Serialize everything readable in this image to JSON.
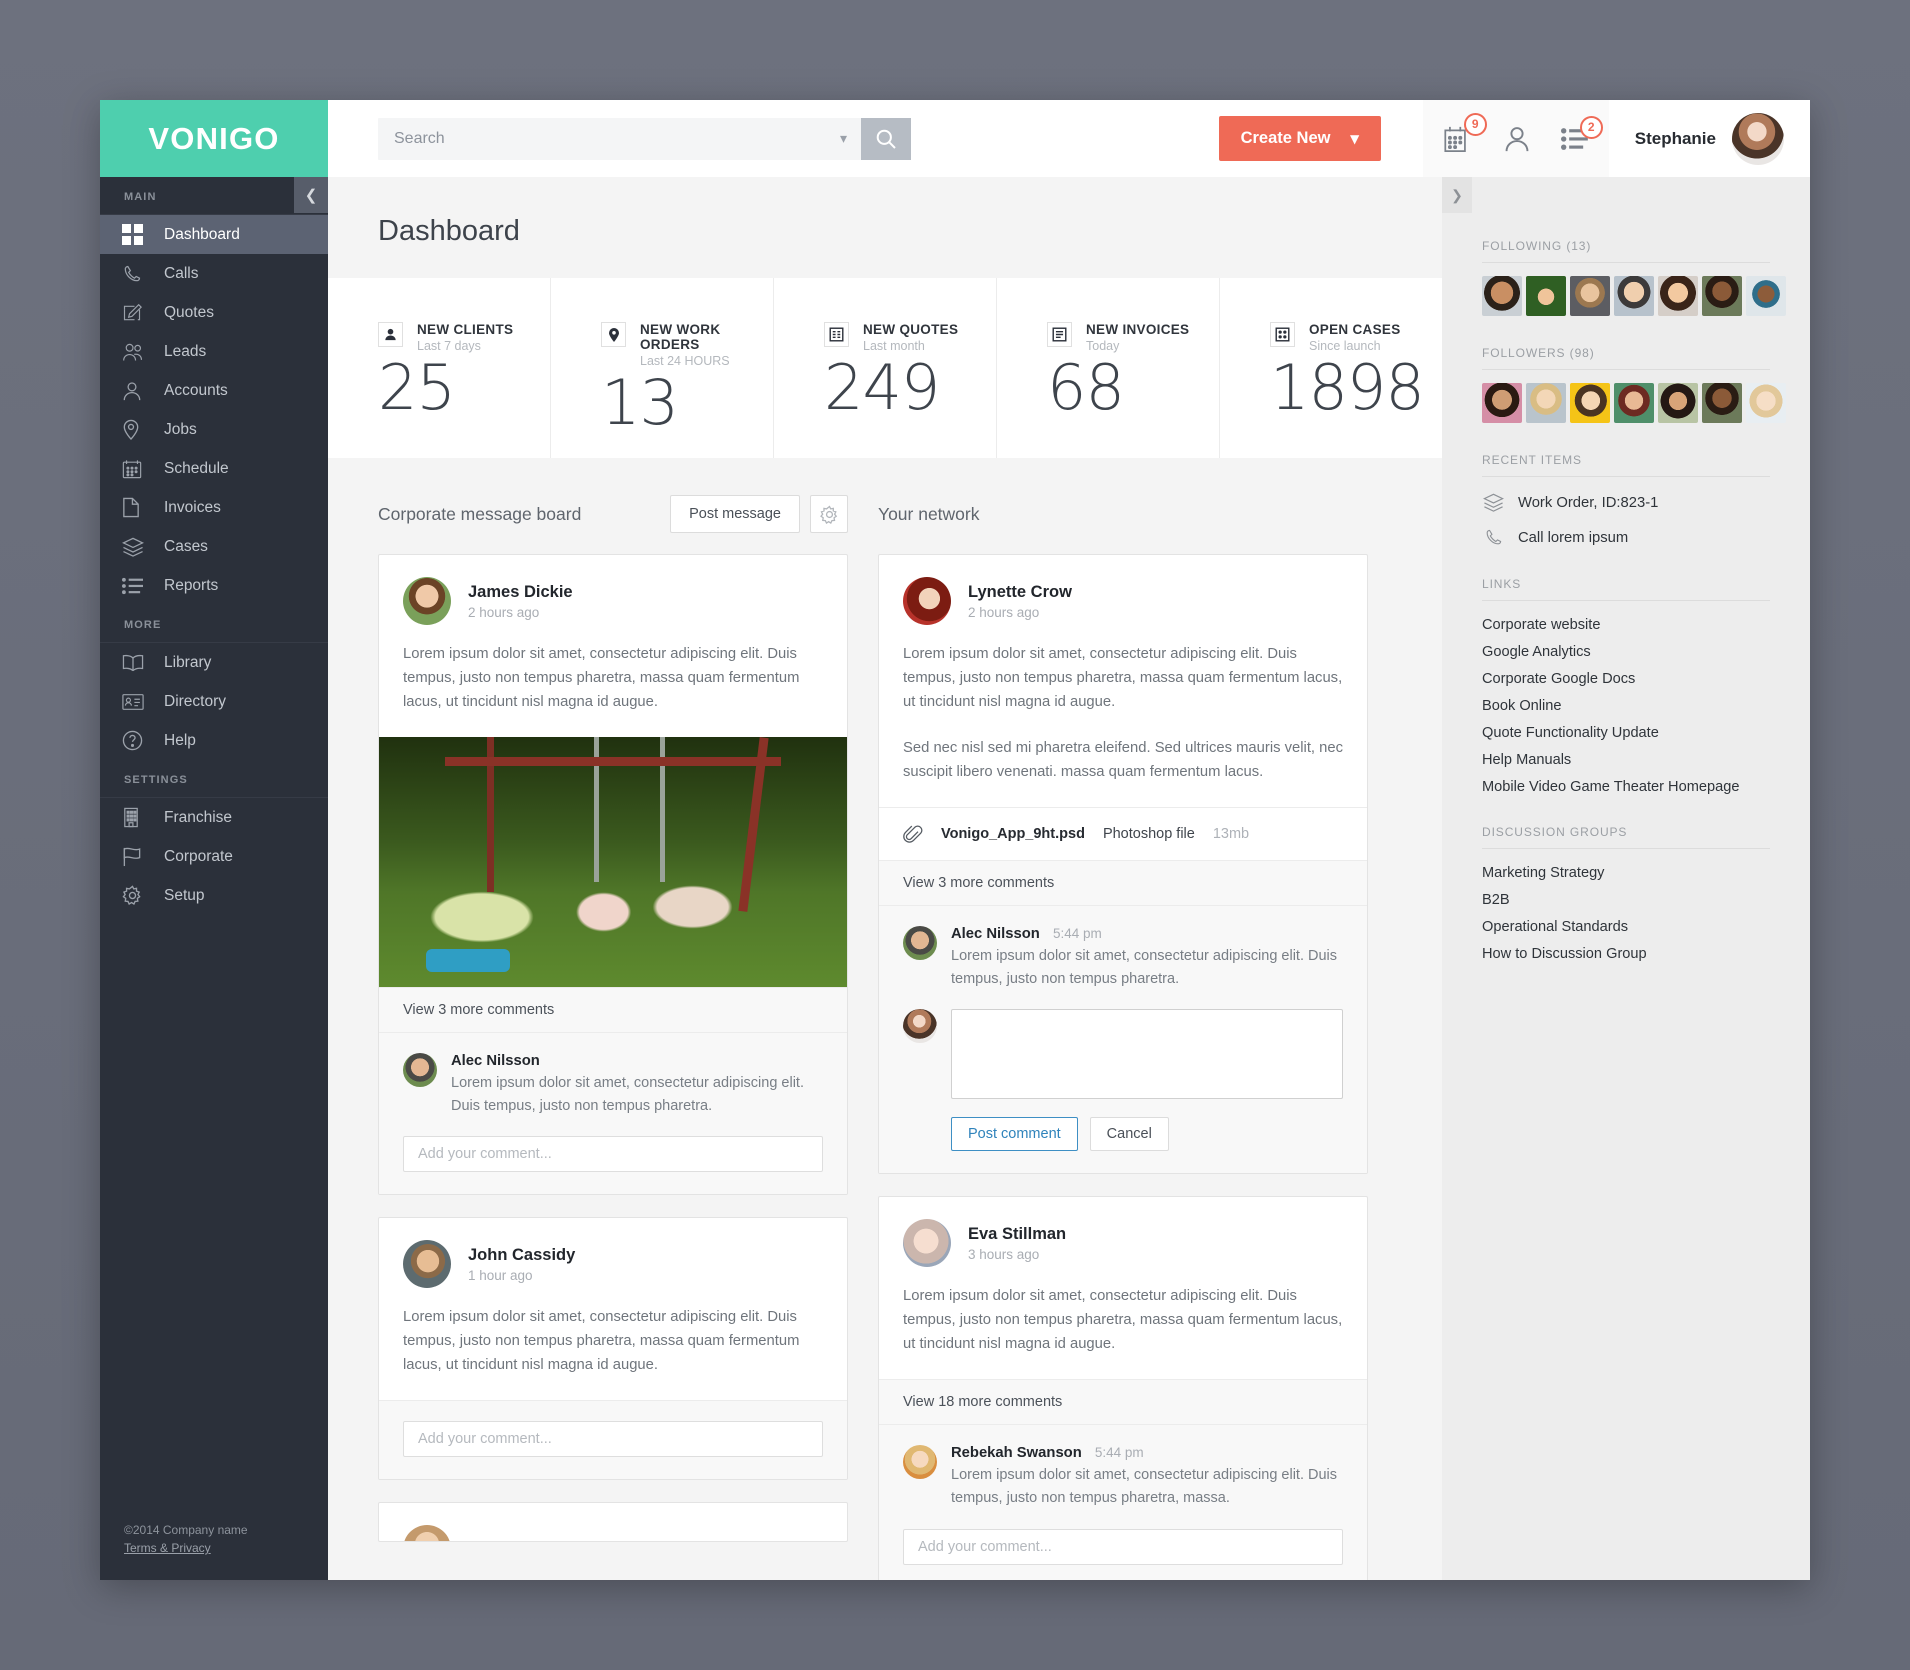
{
  "brand": {
    "logo": "VONIGO",
    "accent": "#4ecfae",
    "cta_color": "#ef6a56"
  },
  "sidebar": {
    "sections": [
      {
        "label": "MAIN",
        "items": [
          {
            "label": "Dashboard",
            "icon": "grid-icon",
            "active": true
          },
          {
            "label": "Calls",
            "icon": "phone-icon"
          },
          {
            "label": "Quotes",
            "icon": "pencil-square-icon"
          },
          {
            "label": "Leads",
            "icon": "users-icon"
          },
          {
            "label": "Accounts",
            "icon": "user-icon"
          },
          {
            "label": "Jobs",
            "icon": "map-pin-icon"
          },
          {
            "label": "Schedule",
            "icon": "calendar-icon"
          },
          {
            "label": "Invoices",
            "icon": "document-icon"
          },
          {
            "label": "Cases",
            "icon": "layers-icon"
          },
          {
            "label": "Reports",
            "icon": "list-icon"
          }
        ]
      },
      {
        "label": "MORE",
        "items": [
          {
            "label": "Library",
            "icon": "book-icon"
          },
          {
            "label": "Directory",
            "icon": "id-card-icon"
          },
          {
            "label": "Help",
            "icon": "question-circle-icon"
          }
        ]
      },
      {
        "label": "SETTINGS",
        "items": [
          {
            "label": "Franchise",
            "icon": "building-icon"
          },
          {
            "label": "Corporate",
            "icon": "flag-icon"
          },
          {
            "label": "Setup",
            "icon": "gear-icon"
          }
        ]
      }
    ],
    "collapse_icon": "chevron-left-icon",
    "footer": {
      "copyright": "©2014 Company name",
      "terms": "Terms & Privacy"
    }
  },
  "topbar": {
    "search_placeholder": "Search",
    "search_value": "",
    "search_caret_icon": "chevron-down-icon",
    "search_button_icon": "search-icon",
    "create_label": "Create New",
    "create_caret_icon": "chevron-down-icon",
    "icons": [
      {
        "name": "calendar-add-icon",
        "badge": "9"
      },
      {
        "name": "user-icon",
        "badge": ""
      },
      {
        "name": "task-list-icon",
        "badge": "2"
      }
    ],
    "user": {
      "name": "Stephanie",
      "avatar": "avatar-stephanie"
    }
  },
  "page": {
    "title": "Dashboard"
  },
  "kpis": [
    {
      "icon": "client-icon",
      "label": "NEW CLIENTS",
      "sub": "Last 7 days",
      "value": "25"
    },
    {
      "icon": "map-pin-icon",
      "label": "NEW WORK ORDERS",
      "sub": "Last 24 HOURS",
      "value": "13"
    },
    {
      "icon": "quote-grid-icon",
      "label": "NEW QUOTES",
      "sub": "Last month",
      "value": "249"
    },
    {
      "icon": "invoice-icon",
      "label": "NEW INVOICES",
      "sub": "Today",
      "value": "68"
    },
    {
      "icon": "cases-grid-icon",
      "label": "OPEN CASES",
      "sub": "Since launch",
      "value": "1898"
    }
  ],
  "message_board": {
    "title": "Corporate message board",
    "post_message_label": "Post message",
    "settings_icon": "gear-icon",
    "posts": [
      {
        "author": "James Dickie",
        "time": "2 hours ago",
        "body": "Lorem ipsum dolor sit amet, consectetur adipiscing elit. Duis tempus, justo non tempus pharetra, massa quam fermentum lacus, ut tincidunt nisl magna id augue.",
        "has_image": true,
        "image_alt": "children-on-swings-photo",
        "view_more": "View 3 more comments",
        "comments": [
          {
            "author": "Alec Nilsson",
            "time": "",
            "text": "Lorem ipsum dolor sit amet, consectetur adipiscing elit. Duis tempus, justo non tempus pharetra."
          }
        ],
        "comment_placeholder": "Add your comment..."
      },
      {
        "author": "John Cassidy",
        "time": "1 hour ago",
        "body": "Lorem ipsum dolor sit amet, consectetur adipiscing elit. Duis tempus, justo non tempus pharetra, massa quam fermentum lacus, ut tincidunt nisl magna id augue.",
        "has_image": false,
        "comment_placeholder": "Add your comment..."
      }
    ]
  },
  "network": {
    "title": "Your network",
    "posts": [
      {
        "author": "Lynette Crow",
        "time": "2 hours ago",
        "body": "Lorem ipsum dolor sit amet, consectetur adipiscing elit. Duis tempus, justo non tempus pharetra, massa quam fermentum lacus, ut tincidunt nisl magna id augue.",
        "body2": "Sed nec nisl sed mi pharetra eleifend. Sed ultrices mauris velit, nec suscipit libero venenati. massa quam fermentum lacus.",
        "attachment": {
          "icon": "paperclip-icon",
          "name": "Vonigo_App_9ht.psd",
          "type": "Photoshop file",
          "size": "13mb"
        },
        "view_more": "View 3 more comments",
        "comments": [
          {
            "author": "Alec Nilsson",
            "time": "5:44 pm",
            "text": "Lorem ipsum dolor sit amet, consectetur adipiscing elit. Duis tempus, justo non tempus pharetra."
          }
        ],
        "compose": {
          "value": "",
          "post_label": "Post comment",
          "cancel_label": "Cancel"
        }
      },
      {
        "author": "Eva Stillman",
        "time": "3 hours ago",
        "body": "Lorem ipsum dolor sit amet, consectetur adipiscing elit. Duis tempus, justo non tempus pharetra, massa quam fermentum lacus, ut tincidunt nisl magna id augue.",
        "view_more": "View 18 more comments",
        "comments": [
          {
            "author": "Rebekah Swanson",
            "time": "5:44 pm",
            "text": "Lorem ipsum dolor sit amet, consectetur adipiscing elit. Duis tempus, justo non tempus pharetra, massa."
          }
        ],
        "comment_placeholder": "Add your comment..."
      }
    ]
  },
  "right_panel": {
    "toggle_icon": "chevron-right-icon",
    "following_label": "FOLLOWING (13)",
    "followers_label": "FOLLOWERS (98)",
    "recent_items_label": "RECENT ITEMS",
    "recent_items": [
      {
        "icon": "layers-icon",
        "label": "Work Order, ID:823-1"
      },
      {
        "icon": "phone-icon",
        "label": "Call lorem ipsum"
      }
    ],
    "links_label": "LINKS",
    "links": [
      "Corporate website",
      "Google Analytics",
      "Corporate Google Docs",
      "Book Online",
      "Quote Functionality Update",
      "Help Manuals",
      "Mobile Video Game Theater Homepage"
    ],
    "groups_label": "DISCUSSION GROUPS",
    "groups": [
      "Marketing Strategy",
      "B2B",
      "Operational Standards",
      "How to Discussion Group"
    ]
  }
}
